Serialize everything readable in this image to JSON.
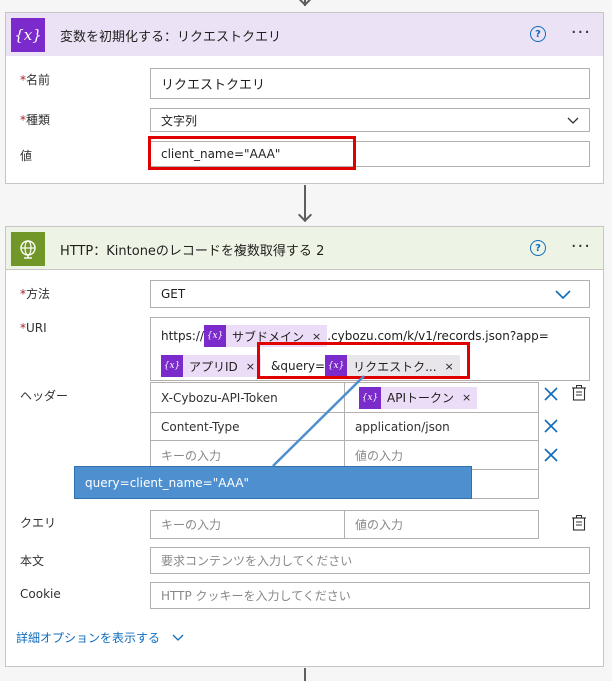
{
  "card1": {
    "icon": "{x}",
    "title": "変数を初期化する：リクエストクエリ",
    "help": "?",
    "more": "···",
    "name_label": "名前",
    "name_value": "リクエストクエリ",
    "type_label": "種類",
    "type_value": "文字列",
    "value_label": "値",
    "value_value": "client_name=\"AAA\""
  },
  "card2": {
    "title": "HTTP：Kintoneのレコードを複数取得する 2",
    "help": "?",
    "more": "···",
    "method_label": "方法",
    "method_value": "GET",
    "uri_label": "URI",
    "uri_prefix": "https://",
    "uri_token_subdomain": "サブドメイン",
    "uri_middle": ".cybozu.com/k/v1/records.json?app=",
    "uri_token_appid": "アプリID",
    "uri_query_text": "&query=",
    "uri_token_query": "リクエストク...",
    "token_icon": "{x}",
    "token_close": "×",
    "headers_label": "ヘッダー",
    "headers": [
      {
        "key": "X-Cybozu-API-Token",
        "value_token": "APIトークン"
      },
      {
        "key": "Content-Type",
        "value": "application/json"
      },
      {
        "key_placeholder": "キーの入力",
        "value_placeholder": "値の入力"
      }
    ],
    "query_label": "クエリ",
    "query_key_placeholder": "キーの入力",
    "query_value_placeholder": "値の入力",
    "body_label": "本文",
    "body_placeholder": "要求コンテンツを入力してください",
    "cookie_label": "Cookie",
    "cookie_placeholder": "HTTP クッキーを入力してください",
    "advanced_link": "詳細オプションを表示する"
  },
  "tooltip": "query=client_name=\"AAA\"",
  "colors": {
    "accent": "#0f6cbd",
    "variable": "#7b2bcc",
    "http": "#709727",
    "highlight": "#e00000",
    "tooltip": "#4e8fcf"
  }
}
